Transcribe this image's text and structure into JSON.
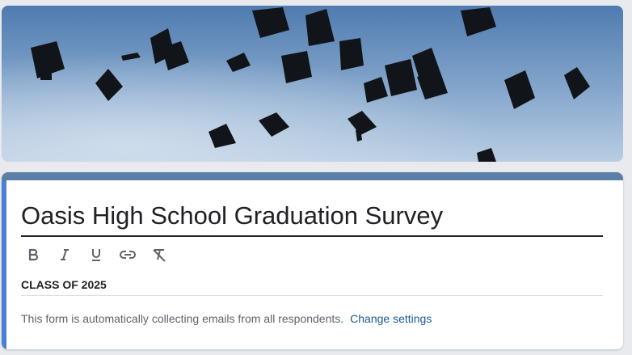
{
  "header": {
    "image": "graduation-caps-thrown-in-sky",
    "sky_top_color": "#4f7bb0",
    "sky_bottom_color": "#b9cde3",
    "cap_color": "#111418"
  },
  "form": {
    "accent_color": "#5b7fa6",
    "left_bar_color": "#4a7fd4",
    "title": "Oasis High School Graduation Survey",
    "toolbar": [
      {
        "name": "bold",
        "icon": "bold-icon"
      },
      {
        "name": "italic",
        "icon": "italic-icon"
      },
      {
        "name": "underline",
        "icon": "underline-icon"
      },
      {
        "name": "link",
        "icon": "link-icon"
      },
      {
        "name": "clear-formatting",
        "icon": "clear-formatting-icon"
      }
    ],
    "description": "CLASS OF 2025",
    "email_notice": "This form is automatically collecting emails from all respondents.",
    "change_settings_label": "Change settings"
  }
}
